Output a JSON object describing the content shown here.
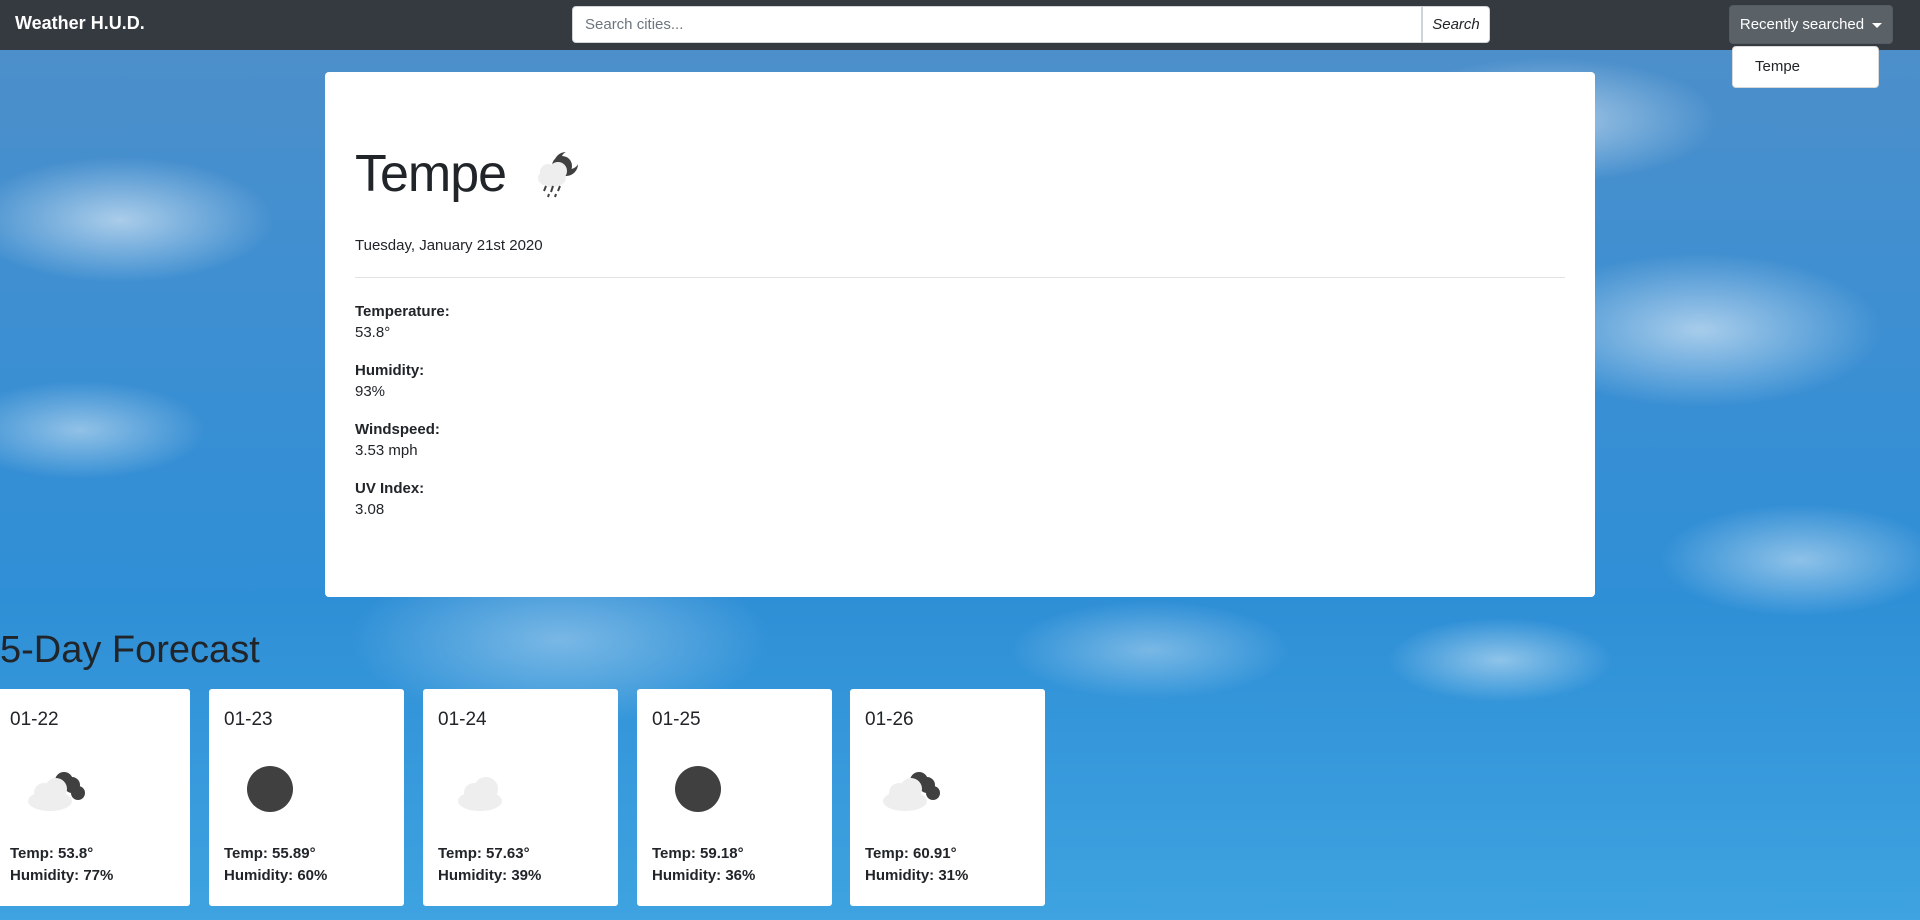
{
  "navbar": {
    "brand": "Weather H.U.D.",
    "search_placeholder": "Search cities...",
    "search_label": "Search",
    "recent_label": "Recently searched",
    "recent_items": [
      "Tempe"
    ]
  },
  "current": {
    "city": "Tempe",
    "icon": "cloud-rain-night-icon",
    "date": "Tuesday, January 21st 2020",
    "stats": [
      {
        "label": "Temperature:",
        "value": "53.8°"
      },
      {
        "label": "Humidity:",
        "value": "93%"
      },
      {
        "label": "Windspeed:",
        "value": "3.53 mph"
      },
      {
        "label": "UV Index:",
        "value": "3.08"
      }
    ]
  },
  "forecast": {
    "title": "5-Day Forecast",
    "days": [
      {
        "date": "01-22",
        "icon": "partly-cloudy-night-icon",
        "temp": "Temp: 53.8°",
        "humidity": "Humidity: 77%"
      },
      {
        "date": "01-23",
        "icon": "clear-night-icon",
        "temp": "Temp: 55.89°",
        "humidity": "Humidity: 60%"
      },
      {
        "date": "01-24",
        "icon": "cloud-icon",
        "temp": "Temp: 57.63°",
        "humidity": "Humidity: 39%"
      },
      {
        "date": "01-25",
        "icon": "clear-night-icon",
        "temp": "Temp: 59.18°",
        "humidity": "Humidity: 36%"
      },
      {
        "date": "01-26",
        "icon": "partly-cloudy-night-icon",
        "temp": "Temp: 60.91°",
        "humidity": "Humidity: 31%"
      }
    ]
  },
  "colors": {
    "navbar": "#343a40",
    "icon_dark": "#404040",
    "icon_cloud": "#eeeeee"
  }
}
